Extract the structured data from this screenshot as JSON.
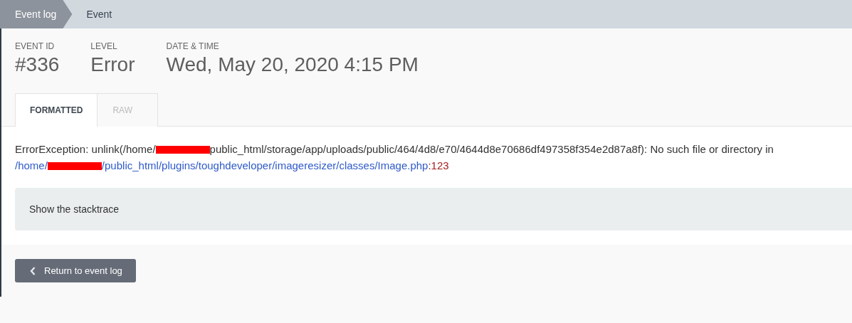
{
  "breadcrumbs": [
    {
      "label": "Event log",
      "selected": false
    },
    {
      "label": "Event",
      "selected": true
    }
  ],
  "fields": [
    {
      "label": "EVENT ID",
      "value": "#336"
    },
    {
      "label": "LEVEL",
      "value": "Error"
    },
    {
      "label": "DATE & TIME",
      "value": "Wed, May 20, 2020 4:15 PM"
    }
  ],
  "tabs": [
    {
      "label": "FORMATTED",
      "selected": true
    },
    {
      "label": "RAW",
      "selected": false
    }
  ],
  "message": [
    {
      "kind": "text",
      "text": "ErrorException: unlink(/home/"
    },
    {
      "kind": "redaction"
    },
    {
      "kind": "text",
      "text": "public_html/storage/app/uploads/public/464/4d8/e70/4644d8e70686df497358f354e2d87a8f): No such file or directory in"
    },
    {
      "kind": "break"
    },
    {
      "kind": "link",
      "text": "/home/"
    },
    {
      "kind": "redaction"
    },
    {
      "kind": "link",
      "text": "/public_html/plugins/toughdeveloper/imageresizer/classes/Image.php"
    },
    {
      "kind": "line",
      "text": ":123"
    }
  ],
  "stacktrace": {
    "label": "Show the stacktrace"
  },
  "return_button": {
    "label": "Return to event log"
  }
}
